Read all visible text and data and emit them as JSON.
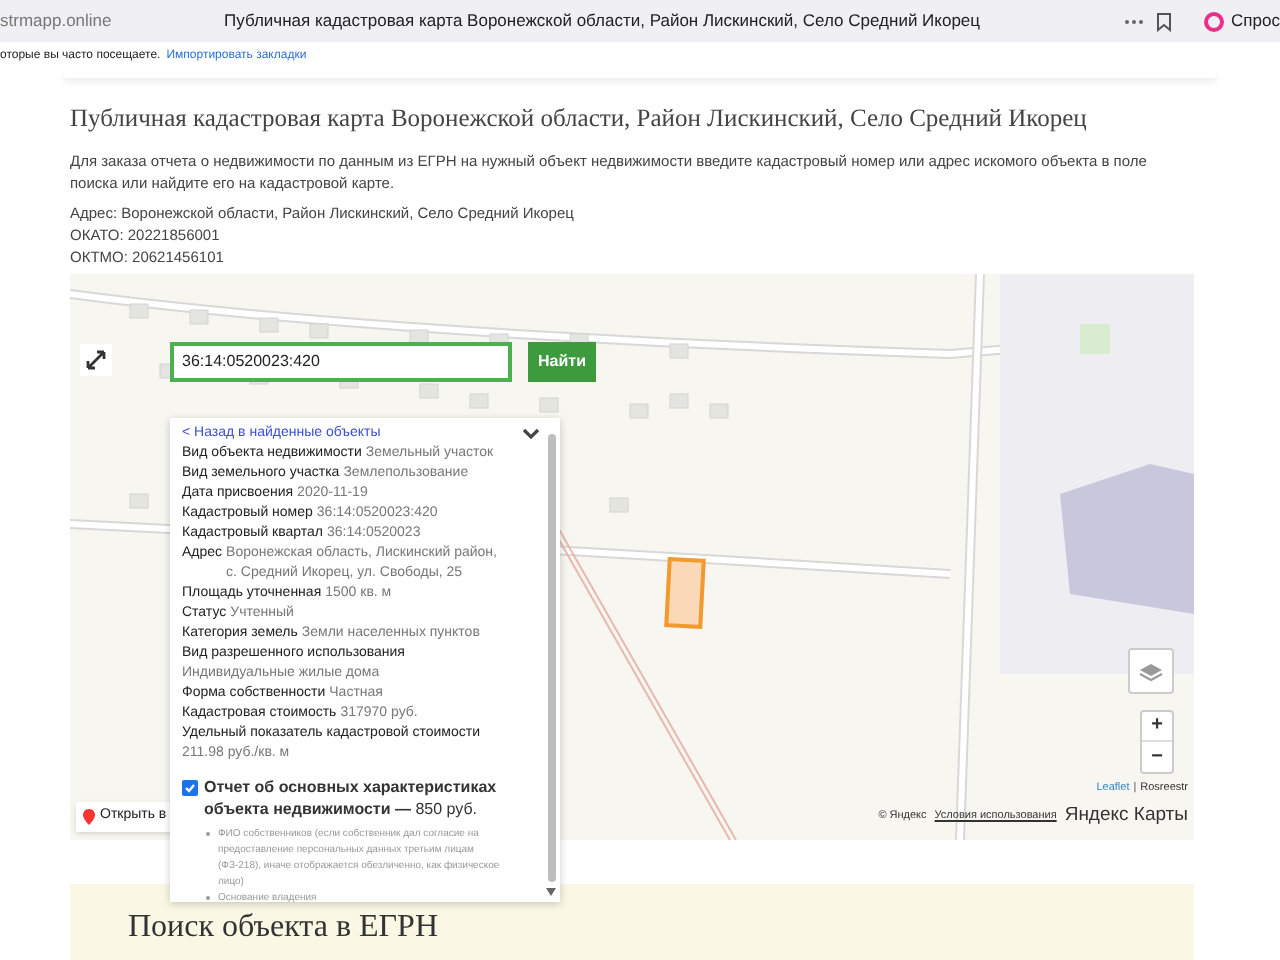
{
  "browser": {
    "url": "strmapp.online",
    "title": "Публичная кадастровая карта Воронежской области, Район Лискинский, Село Средний Икорец",
    "profile_label": "Спрос"
  },
  "bookmarks_bar": {
    "hint": "оторые вы часто посещаете.",
    "link": "Импортировать закладки"
  },
  "page": {
    "title": "Публичная кадастровая карта Воронежской области, Район Лискинский, Село Средний Икорец",
    "intro": "Для заказа отчета о недвижимости по данным из ЕГРН на нужный объект недвижимости введите кадастровый номер или адрес искомого объекта в поле поиска или найдите его на кадастровой карте.",
    "address": "Адрес: Воронежской области, Район Лискинский, Село Средний Икорец",
    "okato": "ОКАТО: 20221856001",
    "oktmo": "ОКТМО: 20621456101"
  },
  "map": {
    "search": {
      "value": "36:14:0520023:420"
    },
    "find_button": "Найти",
    "open_button": "Открыть в",
    "attribution_separator": "|",
    "zoom_in": "+",
    "zoom_out": "−",
    "leaflet": "Leaflet",
    "rosreestr": "Rosreestr",
    "copyright": "© Яндекс",
    "terms": "Условия использования",
    "logo": "Яндекс Карты",
    "popup": {
      "back_link": "< Назад в найденные объекты",
      "fields": [
        {
          "label": "Вид объекта недвижимости",
          "value": "Земельный участок",
          "kind": "inline"
        },
        {
          "label": "Вид земельного участка",
          "value": "Землепользование",
          "kind": "inline"
        },
        {
          "label": "Дата присвоения",
          "value": "2020-11-19",
          "kind": "inline"
        },
        {
          "label": "Кадастровый номер",
          "value": "36:14:0520023:420",
          "kind": "inline"
        },
        {
          "label": "Кадастровый квартал",
          "value": "36:14:0520023",
          "kind": "inline"
        },
        {
          "label": "Адрес",
          "value": "Воронежская область, Лискинский район, с. Средний Икорец, ул. Свободы, 25",
          "kind": "inline"
        },
        {
          "label": "Площадь уточненная",
          "value": "1500 кв. м",
          "kind": "inline"
        },
        {
          "label": "Статус",
          "value": "Учтенный",
          "kind": "inline"
        },
        {
          "label": "Категория земель",
          "value": "Земли населенных пунктов",
          "kind": "inline"
        },
        {
          "label": "Вид разрешенного использования",
          "value": "Индивидуальные жилые дома",
          "kind": "block"
        },
        {
          "label": "Форма собственности",
          "value": "Частная",
          "kind": "inline"
        },
        {
          "label": "Кадастровая стоимость",
          "value": "317970 руб.",
          "kind": "inline"
        },
        {
          "label": "Удельный показатель кадастровой стоимости",
          "value": "211.98 руб./кв. м",
          "kind": "block"
        }
      ],
      "report": {
        "checked": true,
        "text": "**Отчет об основных характеристиках объекта недвижимости —** 850 руб.",
        "bullets": [
          "ФИО собственников (если собственник дал согласие на предоставление персональных данных третьим лицам (ФЗ-218), иначе отображается обезличенно, как физическое лицо)",
          "Основание владения"
        ]
      }
    }
  },
  "section": {
    "title": "Поиск объекта в ЕГРН"
  }
}
